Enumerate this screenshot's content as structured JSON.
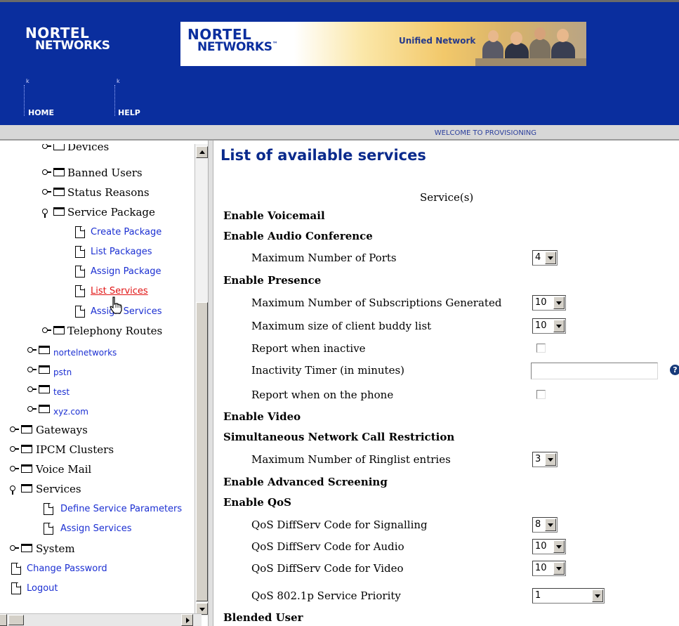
{
  "header": {
    "logo_line1": "NORTEL",
    "logo_line2": "NETWORKS",
    "banner_logo_line1": "NORTEL",
    "banner_logo_line2": "NETWORKS",
    "banner_trademark": "™",
    "banner_tagline": "Unified Network",
    "nav": [
      {
        "label": "HOME"
      },
      {
        "label": "HELP"
      }
    ],
    "nav_tick": "k",
    "welcome": "WELCOME TO PROVISIONING",
    "brand_color": "#0a2e9e"
  },
  "tree": {
    "items": [
      {
        "label": "Devices",
        "type": "folder"
      },
      {
        "label": "Banned Users",
        "type": "folder"
      },
      {
        "label": "Status Reasons",
        "type": "folder"
      },
      {
        "label": "Service Package",
        "type": "folder-open"
      },
      {
        "label": "Create Package",
        "type": "page"
      },
      {
        "label": "List Packages",
        "type": "page"
      },
      {
        "label": "Assign Package",
        "type": "page"
      },
      {
        "label": "List Services",
        "type": "page",
        "state": "active"
      },
      {
        "label": "Assign Services",
        "type": "page"
      },
      {
        "label": "Telephony Routes",
        "type": "folder"
      },
      {
        "label": "nortelnetworks",
        "type": "domain-folder"
      },
      {
        "label": "pstn",
        "type": "domain-folder"
      },
      {
        "label": "test",
        "type": "domain-folder"
      },
      {
        "label": "xyz.com",
        "type": "domain-folder"
      },
      {
        "label": "Gateways",
        "type": "folder"
      },
      {
        "label": "IPCM Clusters",
        "type": "folder"
      },
      {
        "label": "Voice Mail",
        "type": "folder"
      },
      {
        "label": "Services",
        "type": "folder-open"
      },
      {
        "label": "Define Service Parameters",
        "type": "page"
      },
      {
        "label": "Assign Services",
        "type": "page"
      },
      {
        "label": "System",
        "type": "folder"
      },
      {
        "label": "Change Password",
        "type": "page"
      },
      {
        "label": "Logout",
        "type": "page"
      }
    ],
    "link_color": "#1b2fd2",
    "active_color": "#e11414"
  },
  "main": {
    "title": "List of available services",
    "column_header": "Service(s)",
    "rows": [
      {
        "label": "Enable Voicemail",
        "kind": "section"
      },
      {
        "label": "Enable Audio Conference",
        "kind": "section"
      },
      {
        "label": "Maximum Number of Ports",
        "kind": "select",
        "value": "4"
      },
      {
        "label": "Enable Presence",
        "kind": "section"
      },
      {
        "label": "Maximum Number of Subscriptions Generated",
        "kind": "select",
        "value": "10"
      },
      {
        "label": "Maximum size of client buddy list",
        "kind": "select",
        "value": "10"
      },
      {
        "label": "Report when inactive",
        "kind": "checkbox",
        "checked": false
      },
      {
        "label": "Inactivity Timer (in minutes)",
        "kind": "text",
        "value": ""
      },
      {
        "label": "Report when on the phone",
        "kind": "checkbox",
        "checked": false
      },
      {
        "label": "Enable Video",
        "kind": "section"
      },
      {
        "label": "Simultaneous Network Call Restriction",
        "kind": "section"
      },
      {
        "label": "Maximum Number of Ringlist entries",
        "kind": "select",
        "value": "3"
      },
      {
        "label": "Enable Advanced Screening",
        "kind": "section"
      },
      {
        "label": "Enable QoS",
        "kind": "section"
      },
      {
        "label": "QoS DiffServ Code for Signalling",
        "kind": "select",
        "value": "8"
      },
      {
        "label": "QoS DiffServ Code for Audio",
        "kind": "select",
        "value": "10"
      },
      {
        "label": "QoS DiffServ Code for Video",
        "kind": "select",
        "value": "10"
      },
      {
        "label": "QoS 802.1p Service Priority",
        "kind": "select",
        "value": "1"
      },
      {
        "label": "Blended User",
        "kind": "section"
      }
    ],
    "help_icon": "?",
    "title_color": "#0a2a8c"
  }
}
